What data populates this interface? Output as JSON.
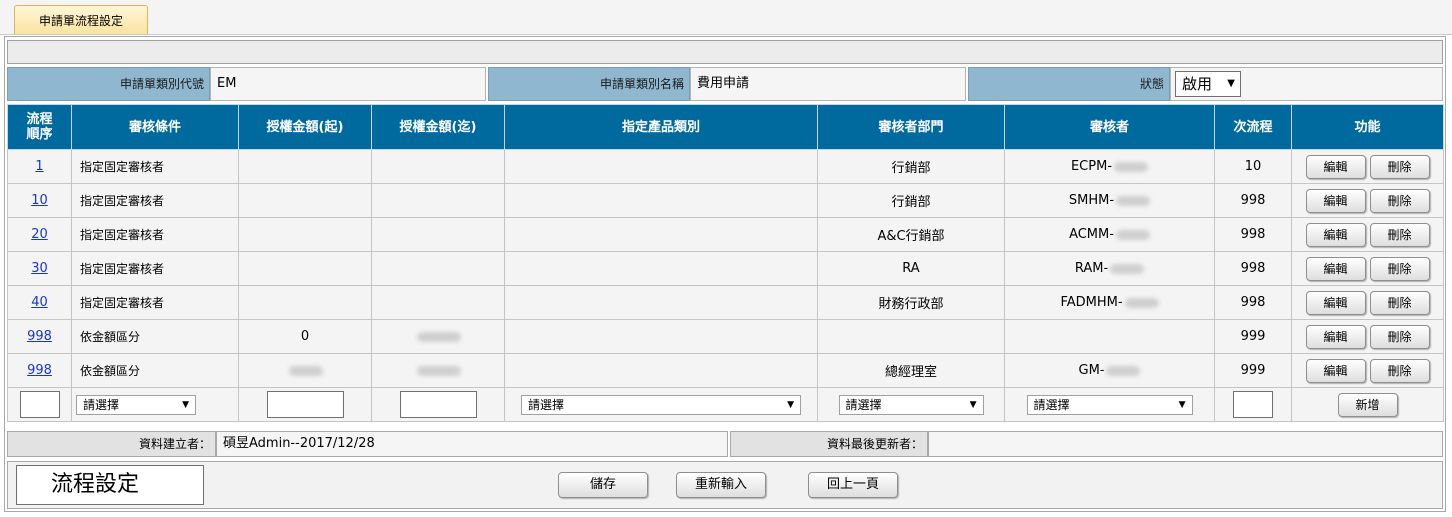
{
  "tab": {
    "label": "申請單流程設定"
  },
  "header": {
    "code_label": "申請單類別代號",
    "code_value": "EM",
    "name_label": "申請單類別名稱",
    "name_value": "費用申請",
    "status_label": "狀態",
    "status_value": "啟用"
  },
  "table": {
    "columns": [
      "流程\n順序",
      "審核條件",
      "授權金額(起)",
      "授權金額(迄)",
      "指定產品類別",
      "審核者部門",
      "審核者",
      "次流程",
      "功能"
    ],
    "rows": [
      {
        "seq": "1",
        "condition": "指定固定審核者",
        "from": "",
        "to": "",
        "product": "",
        "dept": "行銷部",
        "reviewer": "ECPM-",
        "next": "10"
      },
      {
        "seq": "10",
        "condition": "指定固定審核者",
        "from": "",
        "to": "",
        "product": "",
        "dept": "行銷部",
        "reviewer": "SMHM-",
        "next": "998"
      },
      {
        "seq": "20",
        "condition": "指定固定審核者",
        "from": "",
        "to": "",
        "product": "",
        "dept": "A&C行銷部",
        "reviewer": "ACMM-",
        "next": "998"
      },
      {
        "seq": "30",
        "condition": "指定固定審核者",
        "from": "",
        "to": "",
        "product": "",
        "dept": "RA",
        "reviewer": "RAM-",
        "next": "998"
      },
      {
        "seq": "40",
        "condition": "指定固定審核者",
        "from": "",
        "to": "",
        "product": "",
        "dept": "財務行政部",
        "reviewer": "FADMHM-",
        "next": "998"
      },
      {
        "seq": "998",
        "condition": "依金額區分",
        "from": "0",
        "to": "",
        "product": "",
        "dept": "",
        "reviewer": "",
        "next": "999"
      },
      {
        "seq": "998",
        "condition": "依金額區分",
        "from": "",
        "to": "",
        "product": "",
        "dept": "總經理室",
        "reviewer": "GM-",
        "next": "999"
      }
    ],
    "edit_label": "編輯",
    "delete_label": "刪除",
    "new_row": {
      "condition_select": "請選擇",
      "product_select": "請選擇",
      "dept_select": "請選擇",
      "reviewer_select": "請選擇",
      "add_label": "新增"
    }
  },
  "meta": {
    "creator_label": "資料建立者：",
    "creator_value": "碩昱Admin--2017/12/28",
    "updater_label": "資料最後更新者：",
    "updater_value": ""
  },
  "footer": {
    "title": "流程設定",
    "save_label": "儲存",
    "reset_label": "重新輸入",
    "back_label": "回上一頁"
  }
}
